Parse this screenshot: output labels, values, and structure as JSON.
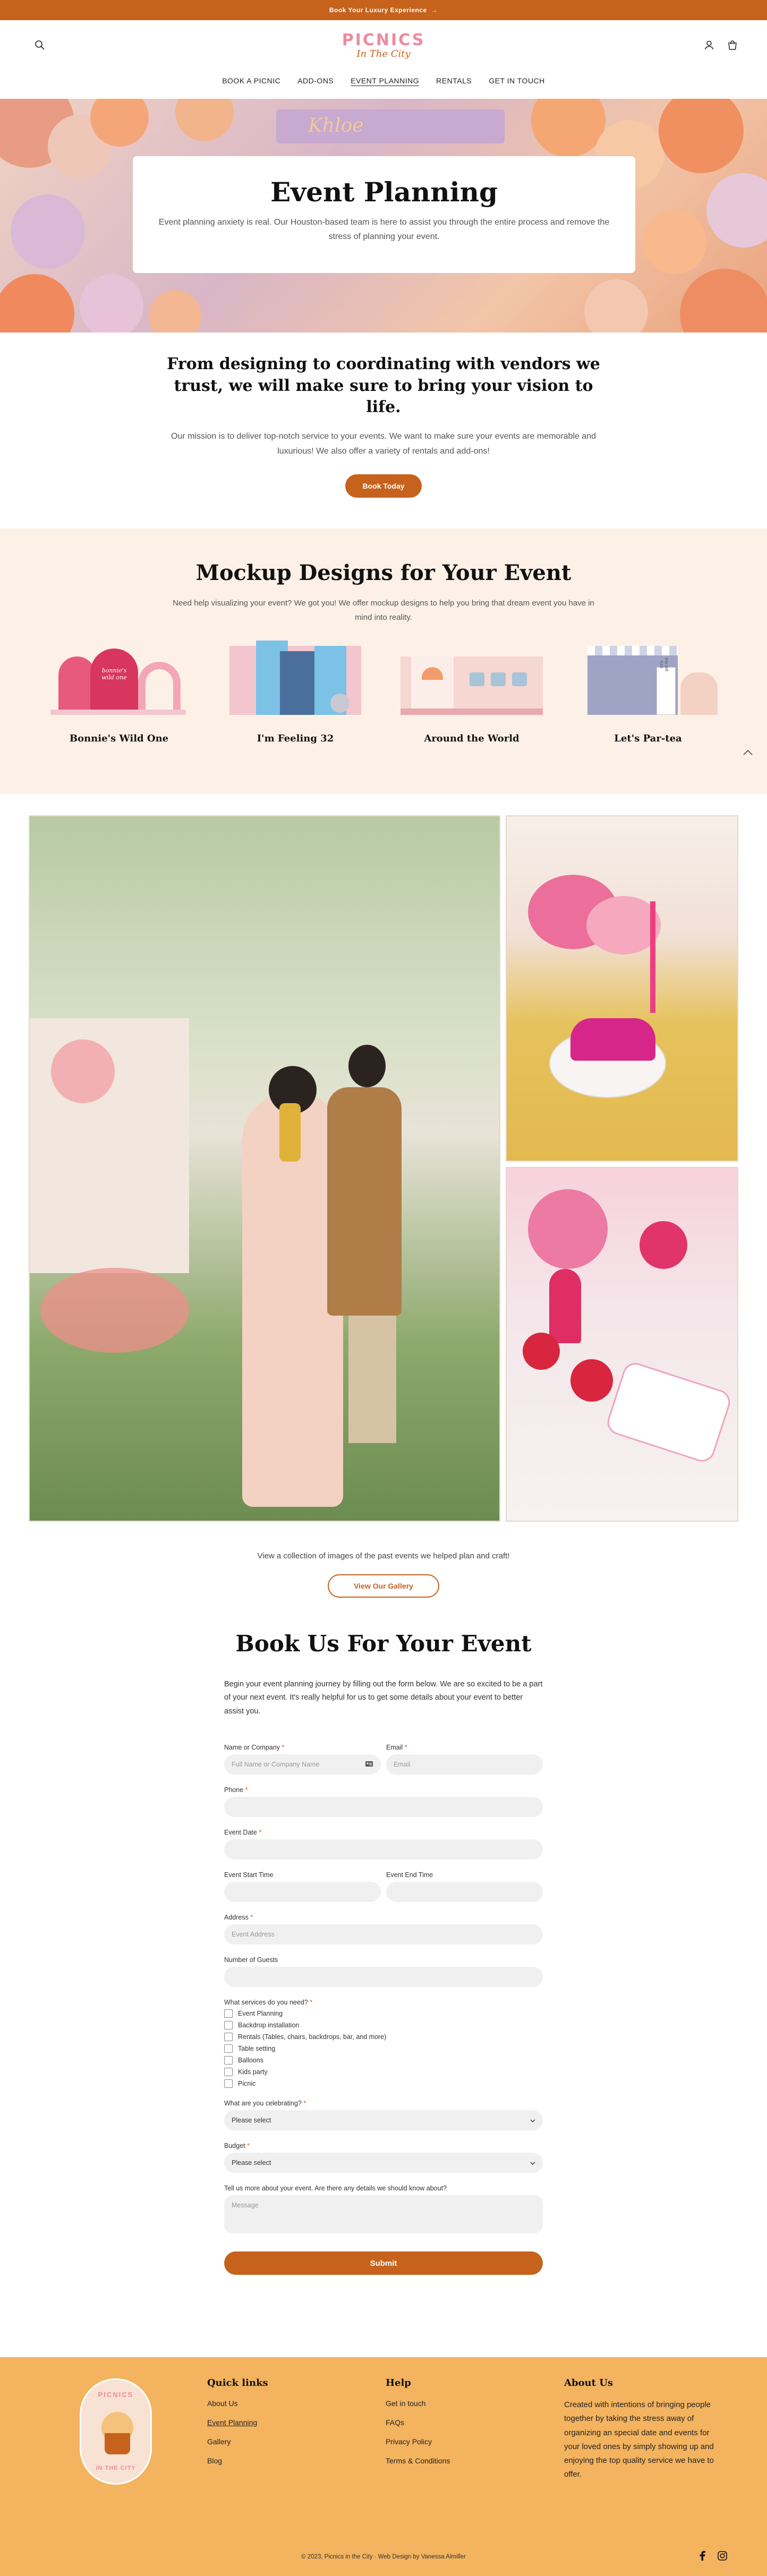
{
  "announcement": {
    "text": "Book Your Luxury Experience",
    "arrow": "→"
  },
  "logo": {
    "line1": "PICNICS",
    "line2": "In The City"
  },
  "nav": [
    "BOOK A PICNIC",
    "ADD-ONS",
    "EVENT PLANNING",
    "RENTALS",
    "GET IN TOUCH"
  ],
  "hero": {
    "banner_text": "Khloe",
    "title": "Event Planning",
    "text": "Event planning anxiety is real. Our Houston-based team is here to assist you through the entire process and remove the stress of planning your event."
  },
  "mission": {
    "heading": "From designing to coordinating with vendors we trust, we will make sure to bring your vision to life.",
    "text": "Our mission is to deliver top-notch service to your events. We want to make sure your events are memorable and luxurious! We also offer a variety of rentals and add-ons!",
    "button": "Book Today"
  },
  "mockups": {
    "title": "Mockup Designs for Your Event",
    "text": "Need help visualizing your event? We got you! We offer mockup designs to help you bring that dream event you have in mind into reality.",
    "items": [
      {
        "caption": "Bonnie's Wild One",
        "sign": "bonnie's wild one"
      },
      {
        "caption": "I'm Feeling 32",
        "sign": ""
      },
      {
        "caption": "Around the World",
        "sign": ""
      },
      {
        "caption": "Let's Par-tea",
        "sign": "let's par-tea"
      }
    ]
  },
  "gallery": {
    "caption": "View a collection of images of the past events we helped plan and craft!",
    "button": "View Our Gallery"
  },
  "form": {
    "title": "Book Us For Your Event",
    "intro": "Begin your event planning journey by filling out the form below. We are so excited to be a part of your next event. It's really helpful for us to get some details about your event to better assist you.",
    "name_label": "Name or Company",
    "name_placeholder": "Full Name or Company Name",
    "email_label": "Email",
    "email_placeholder": "Email",
    "phone_label": "Phone",
    "date_label": "Event Date",
    "start_label": "Event Start Time",
    "end_label": "Event End Time",
    "address_label": "Address",
    "address_placeholder": "Event Address",
    "guests_label": "Number of Guests",
    "services_label": "What services do you need?",
    "services": [
      "Event Planning",
      "Backdrop installation",
      "Rentals (Tables, chairs, backdrops, bar, and more)",
      "Table setting",
      "Balloons",
      "Kids party",
      "Picnic"
    ],
    "celebrating_label": "What are you celebrating?",
    "select_placeholder": "Please select",
    "budget_label": "Budget",
    "message_label": "Tell us more about your event. Are there any details we should know about?",
    "message_placeholder": "Message",
    "submit": "Submit"
  },
  "footer": {
    "badge_top": "PICNICS",
    "badge_bottom": "IN THE CITY",
    "quick_title": "Quick links",
    "quick": [
      "About Us",
      "Event Planning",
      "Gallery",
      "Blog"
    ],
    "help_title": "Help",
    "help": [
      "Get in touch",
      "FAQs",
      "Privacy Policy",
      "Terms & Conditions"
    ],
    "about_title": "About Us",
    "about_text": "Created with intentions of bringing people together by taking the stress away of organizing an special date and events for your loved ones by simply showing up and enjoying the top quality service we have to offer.",
    "copyright": "© 2023, Picnics in the City · Web Design by Vanessa Almiller"
  },
  "colors": {
    "accent": "#c6621c",
    "cream": "#fdf1e7",
    "footer": "#f3b35f",
    "pink": "#ee8aa0"
  }
}
